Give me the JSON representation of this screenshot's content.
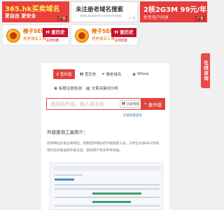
{
  "ads": {
    "ad1": {
      "title": "365.hk买卖域名",
      "subtitle": "更自由 更安全",
      "tag": "广告"
    },
    "ad2": {
      "title": "未注册老域名搜索",
      "url": "aiqi.juzaxin.com/shop",
      "tag": "广告"
    },
    "ad3": {
      "title": "2核2G3M 99元/年",
      "subtitle": "新老用户同享",
      "tag": "广告"
    },
    "ad4": {
      "title": "橙子SEO",
      "subtitle": "抢老域名工具",
      "badge": "H 查历史",
      "badge_sub": "支持批量"
    },
    "ad5": {
      "title": "橙子SEO",
      "subtitle": "抢老域名工具",
      "badge": "H 查历史",
      "badge_sub": "支持批量"
    }
  },
  "side_tab": {
    "label": "在线咨询"
  },
  "tabs": [
    {
      "label": "查外链",
      "icon": "link-icon",
      "active": true
    },
    {
      "label": "查历史",
      "icon": "history-icon",
      "active": false
    },
    {
      "label": "搜老域名",
      "icon": "search-domain-icon",
      "active": false
    },
    {
      "label": "Whois",
      "icon": "globe-icon",
      "active": false
    },
    {
      "label": "标题注册检测",
      "icon": "check-icon",
      "active": false
    },
    {
      "label": "文章关键词分析",
      "icon": "doc-icon",
      "active": false
    }
  ],
  "search": {
    "placeholder": "查网站外链，输入域名如",
    "quick_label": "历史快照",
    "button_label": "查外链"
  },
  "external_link": "外链批量查询",
  "section": {
    "title": "外链查询工具简介：",
    "description": "提供网站外链主要特征、侧重提供网站的外链搜索工具，方便生长做SEO外链、将历史权重由网外链信息，帮助用户更多参考依据。"
  }
}
